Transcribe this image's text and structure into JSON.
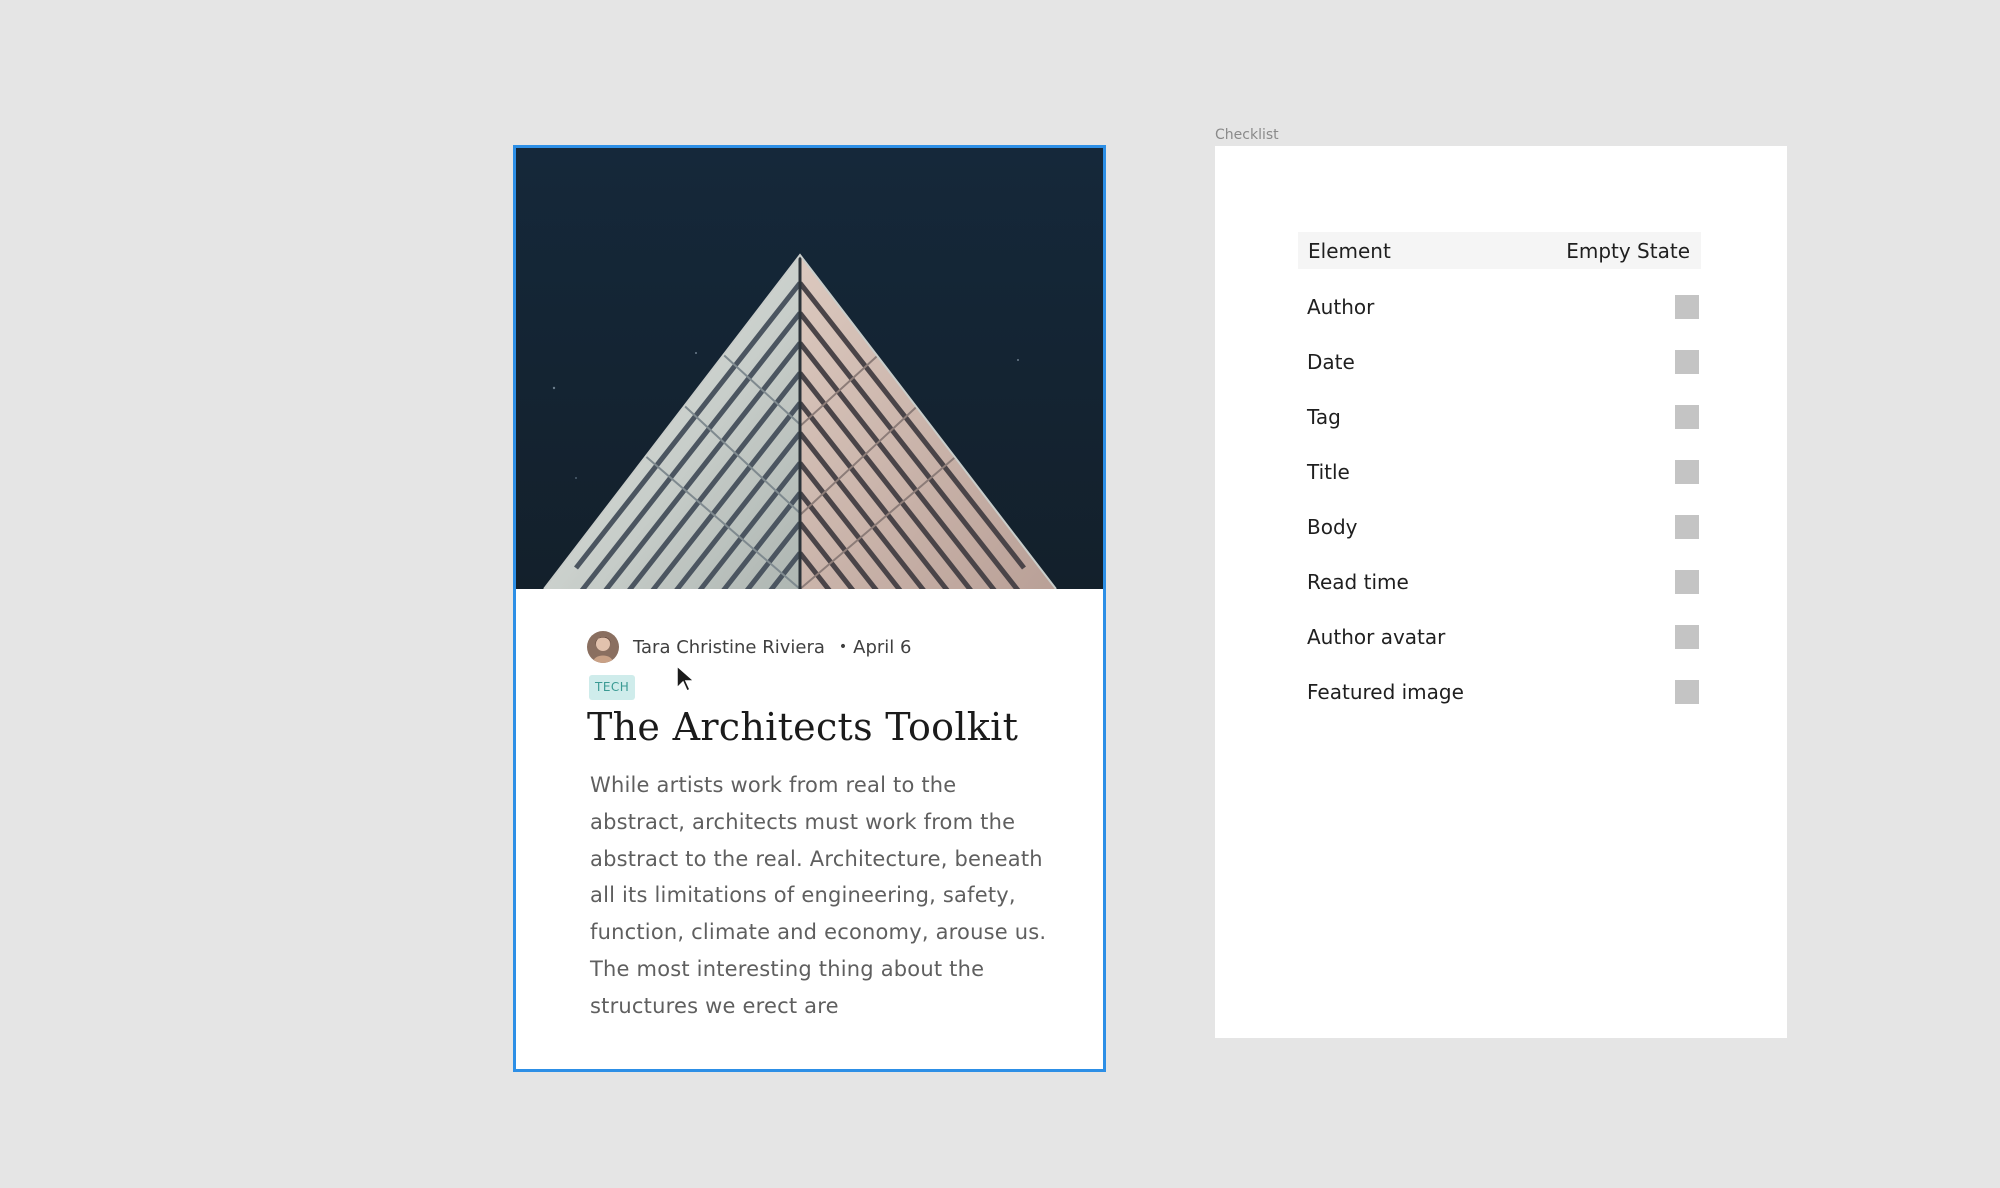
{
  "card": {
    "author": "Tara Christine Riviera",
    "date": "April 6",
    "tag": "TECH",
    "title": "The Architects Toolkit",
    "body": "While artists work from real to the abstract, architects must work from the abstract to the real. Architecture, beneath all its limitations of engineering, safety, function, climate and economy, arouse us. The most interesting thing about the structures we erect are"
  },
  "checklist": {
    "label": "Checklist",
    "header": {
      "element": "Element",
      "empty_state": "Empty State"
    },
    "rows": [
      {
        "label": "Author",
        "checked": false
      },
      {
        "label": "Date",
        "checked": false
      },
      {
        "label": "Tag",
        "checked": false
      },
      {
        "label": "Title",
        "checked": false
      },
      {
        "label": "Body",
        "checked": false
      },
      {
        "label": "Read time",
        "checked": false
      },
      {
        "label": "Author avatar",
        "checked": false
      },
      {
        "label": "Featured image",
        "checked": false
      }
    ]
  },
  "colors": {
    "canvas": "#e5e5e5",
    "selection": "#2d8fe6",
    "hero_sky": "#13222f",
    "tag_bg": "#cfeceb",
    "tag_text": "#3a9a93",
    "checkbox": "#c4c4c4"
  },
  "icons": {
    "cursor": "arrow-cursor-icon"
  }
}
